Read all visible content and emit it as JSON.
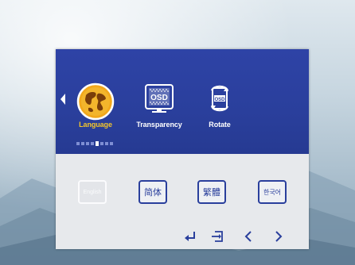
{
  "menu": {
    "items": [
      {
        "label": "Language",
        "icon": "globe-icon",
        "active": true
      },
      {
        "label": "Transparency",
        "icon": "osd-transparency-icon",
        "active": false
      },
      {
        "label": "Rotate",
        "icon": "osd-rotate-icon",
        "active": false
      }
    ],
    "page_dots": 8,
    "current_dot": 4,
    "osd_icon_text": "OSD"
  },
  "languages": [
    {
      "label": "English",
      "state": "disabled"
    },
    {
      "label": "简体",
      "state": "normal"
    },
    {
      "label": "繁體",
      "state": "normal"
    },
    {
      "label": "한국어",
      "state": "normal"
    }
  ],
  "nav": {
    "enter": "enter-icon",
    "exit": "exit-icon",
    "left": "chevron-left-icon",
    "right": "chevron-right-icon"
  },
  "colors": {
    "menu_bg": "#2a3f9c",
    "active_label": "#f3c62b",
    "panel_bg": "#e7e9ec"
  }
}
